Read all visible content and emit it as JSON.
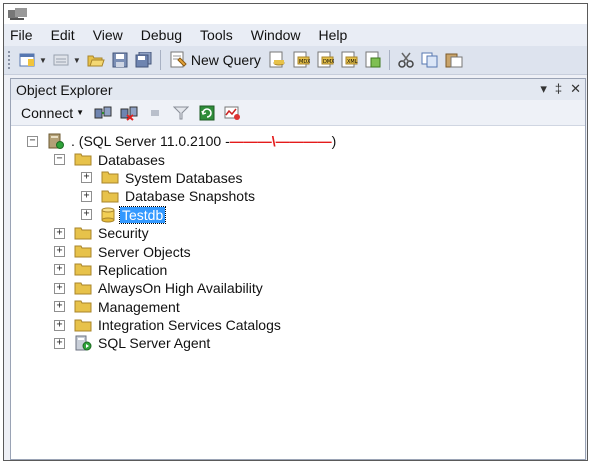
{
  "menu": [
    "File",
    "Edit",
    "View",
    "Debug",
    "Tools",
    "Window",
    "Help"
  ],
  "toolbar": {
    "new_query_label": "New Query"
  },
  "object_explorer": {
    "title": "Object Explorer",
    "controls": [
      "▾",
      "‡",
      "✕"
    ],
    "connect_label": "Connect"
  },
  "tree": {
    "server": {
      "label": ". (SQL Server 11.0.2100 - ",
      "redacted": "———\\————",
      "suffix": ")"
    },
    "databases": "Databases",
    "system_databases": "System Databases",
    "database_snapshots": "Database Snapshots",
    "testdb": "Testdb",
    "security": "Security",
    "server_objects": "Server Objects",
    "replication": "Replication",
    "alwayson": "AlwaysOn High Availability",
    "management": "Management",
    "integration_services": "Integration Services Catalogs",
    "sql_server_agent": "SQL Server Agent",
    "expand_symbol": "+",
    "collapse_symbol": "−"
  },
  "colors": {
    "folder": "#e7c24a",
    "selection": "#3399ff",
    "redacted": "#e41b1b"
  }
}
